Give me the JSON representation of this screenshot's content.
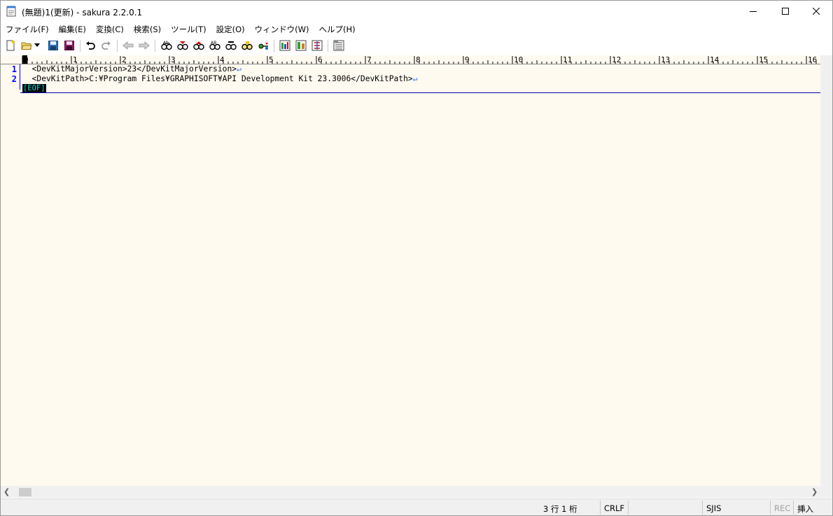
{
  "window": {
    "title": "(無題)1(更新) - sakura 2.2.0.1",
    "controls": {
      "minimize": "minimize-icon",
      "maximize": "maximize-icon",
      "close": "close-icon"
    }
  },
  "menu": [
    "ファイル(F)",
    "編集(E)",
    "変換(C)",
    "検索(S)",
    "ツール(T)",
    "設定(O)",
    "ウィンドウ(W)",
    "ヘルプ(H)"
  ],
  "toolbar": {
    "icons": [
      "new-file-icon",
      "open-file-icon",
      "open-dropdown-icon",
      "save-icon",
      "save-as-icon",
      "undo-icon",
      "redo-icon",
      "back-jump-icon",
      "forward-jump-icon",
      "search-icon",
      "search-prev-icon",
      "search-next-icon",
      "replace-icon",
      "highlight-search-icon",
      "jump-icon",
      "grep-icon",
      "outline-icon",
      "compare-icon",
      "tag-jump-icon",
      "settings-list-icon"
    ]
  },
  "ruler": {
    "marks": [
      "0",
      "1",
      "2",
      "3",
      "4",
      "5",
      "6",
      "7",
      "8",
      "9",
      "10",
      "11",
      "12",
      "13",
      "14",
      "15",
      "16"
    ]
  },
  "editor": {
    "lines": [
      {
        "number": "1",
        "text": "  <DevKitMajorVersion>23</DevKitMajorVersion>",
        "eol": "↵"
      },
      {
        "number": "2",
        "text": "  <DevKitPath>C:¥Program Files¥GRAPHISOFT¥API Development Kit 23.3006</DevKitPath>",
        "eol": "↵"
      }
    ],
    "eof_marker": "[EOF]"
  },
  "statusbar": {
    "position": "3 行   1 桁",
    "line_ending": "CRLF",
    "encoding": "SJIS",
    "rec": "REC",
    "mode": "挿入"
  },
  "colors": {
    "editor_bg": "#fffaf0",
    "line_number": "#0000ff",
    "eol_mark": "#2a6fff",
    "eof_fg": "#00e0e0"
  }
}
